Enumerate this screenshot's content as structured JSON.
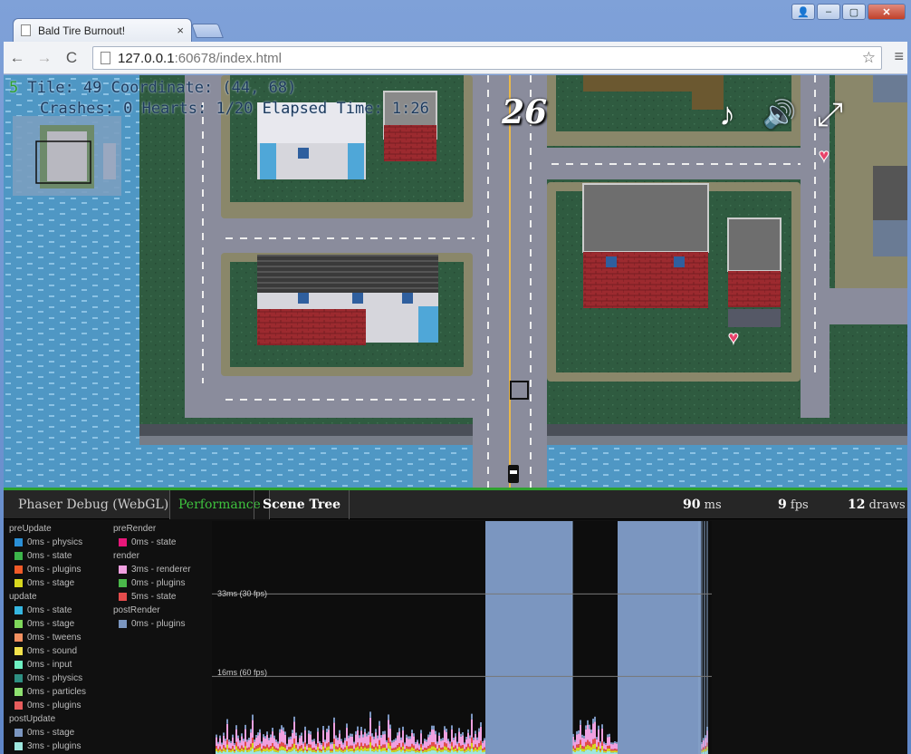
{
  "browser": {
    "tab_title": "Bald Tire Burnout!",
    "tab_close": "×",
    "url_host": "127.0.0.1",
    "url_rest": ":60678/index.html",
    "back": "←",
    "forward": "→",
    "reload": "C",
    "star": "☆",
    "menu": "≡",
    "win_user": "👤",
    "win_min": "–",
    "win_max": "▢",
    "win_close": "✕"
  },
  "game": {
    "hud_line1_prefix": "5",
    "hud_line1": "Tile: 49 Coordinate: (44, 68)",
    "hud_line2": "Crashes: 0 Hearts: 1/20 Elapsed Time: 1:26",
    "score": "26",
    "icons": [
      "music-icon",
      "speaker-icon",
      "fullscreen-icon"
    ],
    "music_glyph": "♪",
    "speaker_glyph": "🔊",
    "fullscreen_glyph": "⤢",
    "heart_glyph": "♥"
  },
  "debug": {
    "title": "Phaser Debug (WebGL):",
    "tabs": [
      "Performance",
      "Scene Tree"
    ],
    "stats": [
      {
        "value": "90",
        "unit": "ms"
      },
      {
        "value": "9",
        "unit": "fps"
      },
      {
        "value": "12",
        "unit": "draws"
      }
    ],
    "legend_col1": [
      {
        "group": "preUpdate",
        "items": [
          {
            "label": "0ms - physics",
            "color": "#2a8fd6"
          },
          {
            "label": "0ms - state",
            "color": "#3cb44a"
          },
          {
            "label": "0ms - plugins",
            "color": "#f05a28"
          },
          {
            "label": "0ms - stage",
            "color": "#d7d71e"
          }
        ]
      },
      {
        "group": "update",
        "items": [
          {
            "label": "0ms - state",
            "color": "#35b6e0"
          },
          {
            "label": "0ms - stage",
            "color": "#7ed65a"
          },
          {
            "label": "0ms - tweens",
            "color": "#f29060"
          },
          {
            "label": "0ms - sound",
            "color": "#f2e24c"
          },
          {
            "label": "0ms - input",
            "color": "#6ef0c2"
          },
          {
            "label": "0ms - physics",
            "color": "#2e8f82"
          },
          {
            "label": "0ms - particles",
            "color": "#8ee070"
          },
          {
            "label": "0ms - plugins",
            "color": "#e65c5c"
          }
        ]
      },
      {
        "group": "postUpdate",
        "items": [
          {
            "label": "0ms - stage",
            "color": "#7b96c0"
          },
          {
            "label": "3ms - plugins",
            "color": "#9ee6de"
          }
        ]
      }
    ],
    "legend_col2": [
      {
        "group": "preRender",
        "items": [
          {
            "label": "0ms - state",
            "color": "#e8177a"
          }
        ]
      },
      {
        "group": "render",
        "items": [
          {
            "label": "3ms - renderer",
            "color": "#f0a0e0"
          },
          {
            "label": "0ms - plugins",
            "color": "#4ab84a"
          },
          {
            "label": "5ms - state",
            "color": "#e44c4c"
          }
        ]
      },
      {
        "group": "postRender",
        "items": [
          {
            "label": "0ms - plugins",
            "color": "#7b96c0"
          }
        ]
      }
    ],
    "graph_lines": [
      "33ms (30 fps)",
      "16ms (60 fps)"
    ]
  },
  "chart_data": {
    "type": "bar",
    "title": "",
    "reference_lines": [
      {
        "label": "33ms (30 fps)",
        "value": 33
      },
      {
        "label": "16ms (60 fps)",
        "value": 16
      }
    ],
    "spike_value": 90,
    "ylim": [
      0,
      48
    ]
  }
}
